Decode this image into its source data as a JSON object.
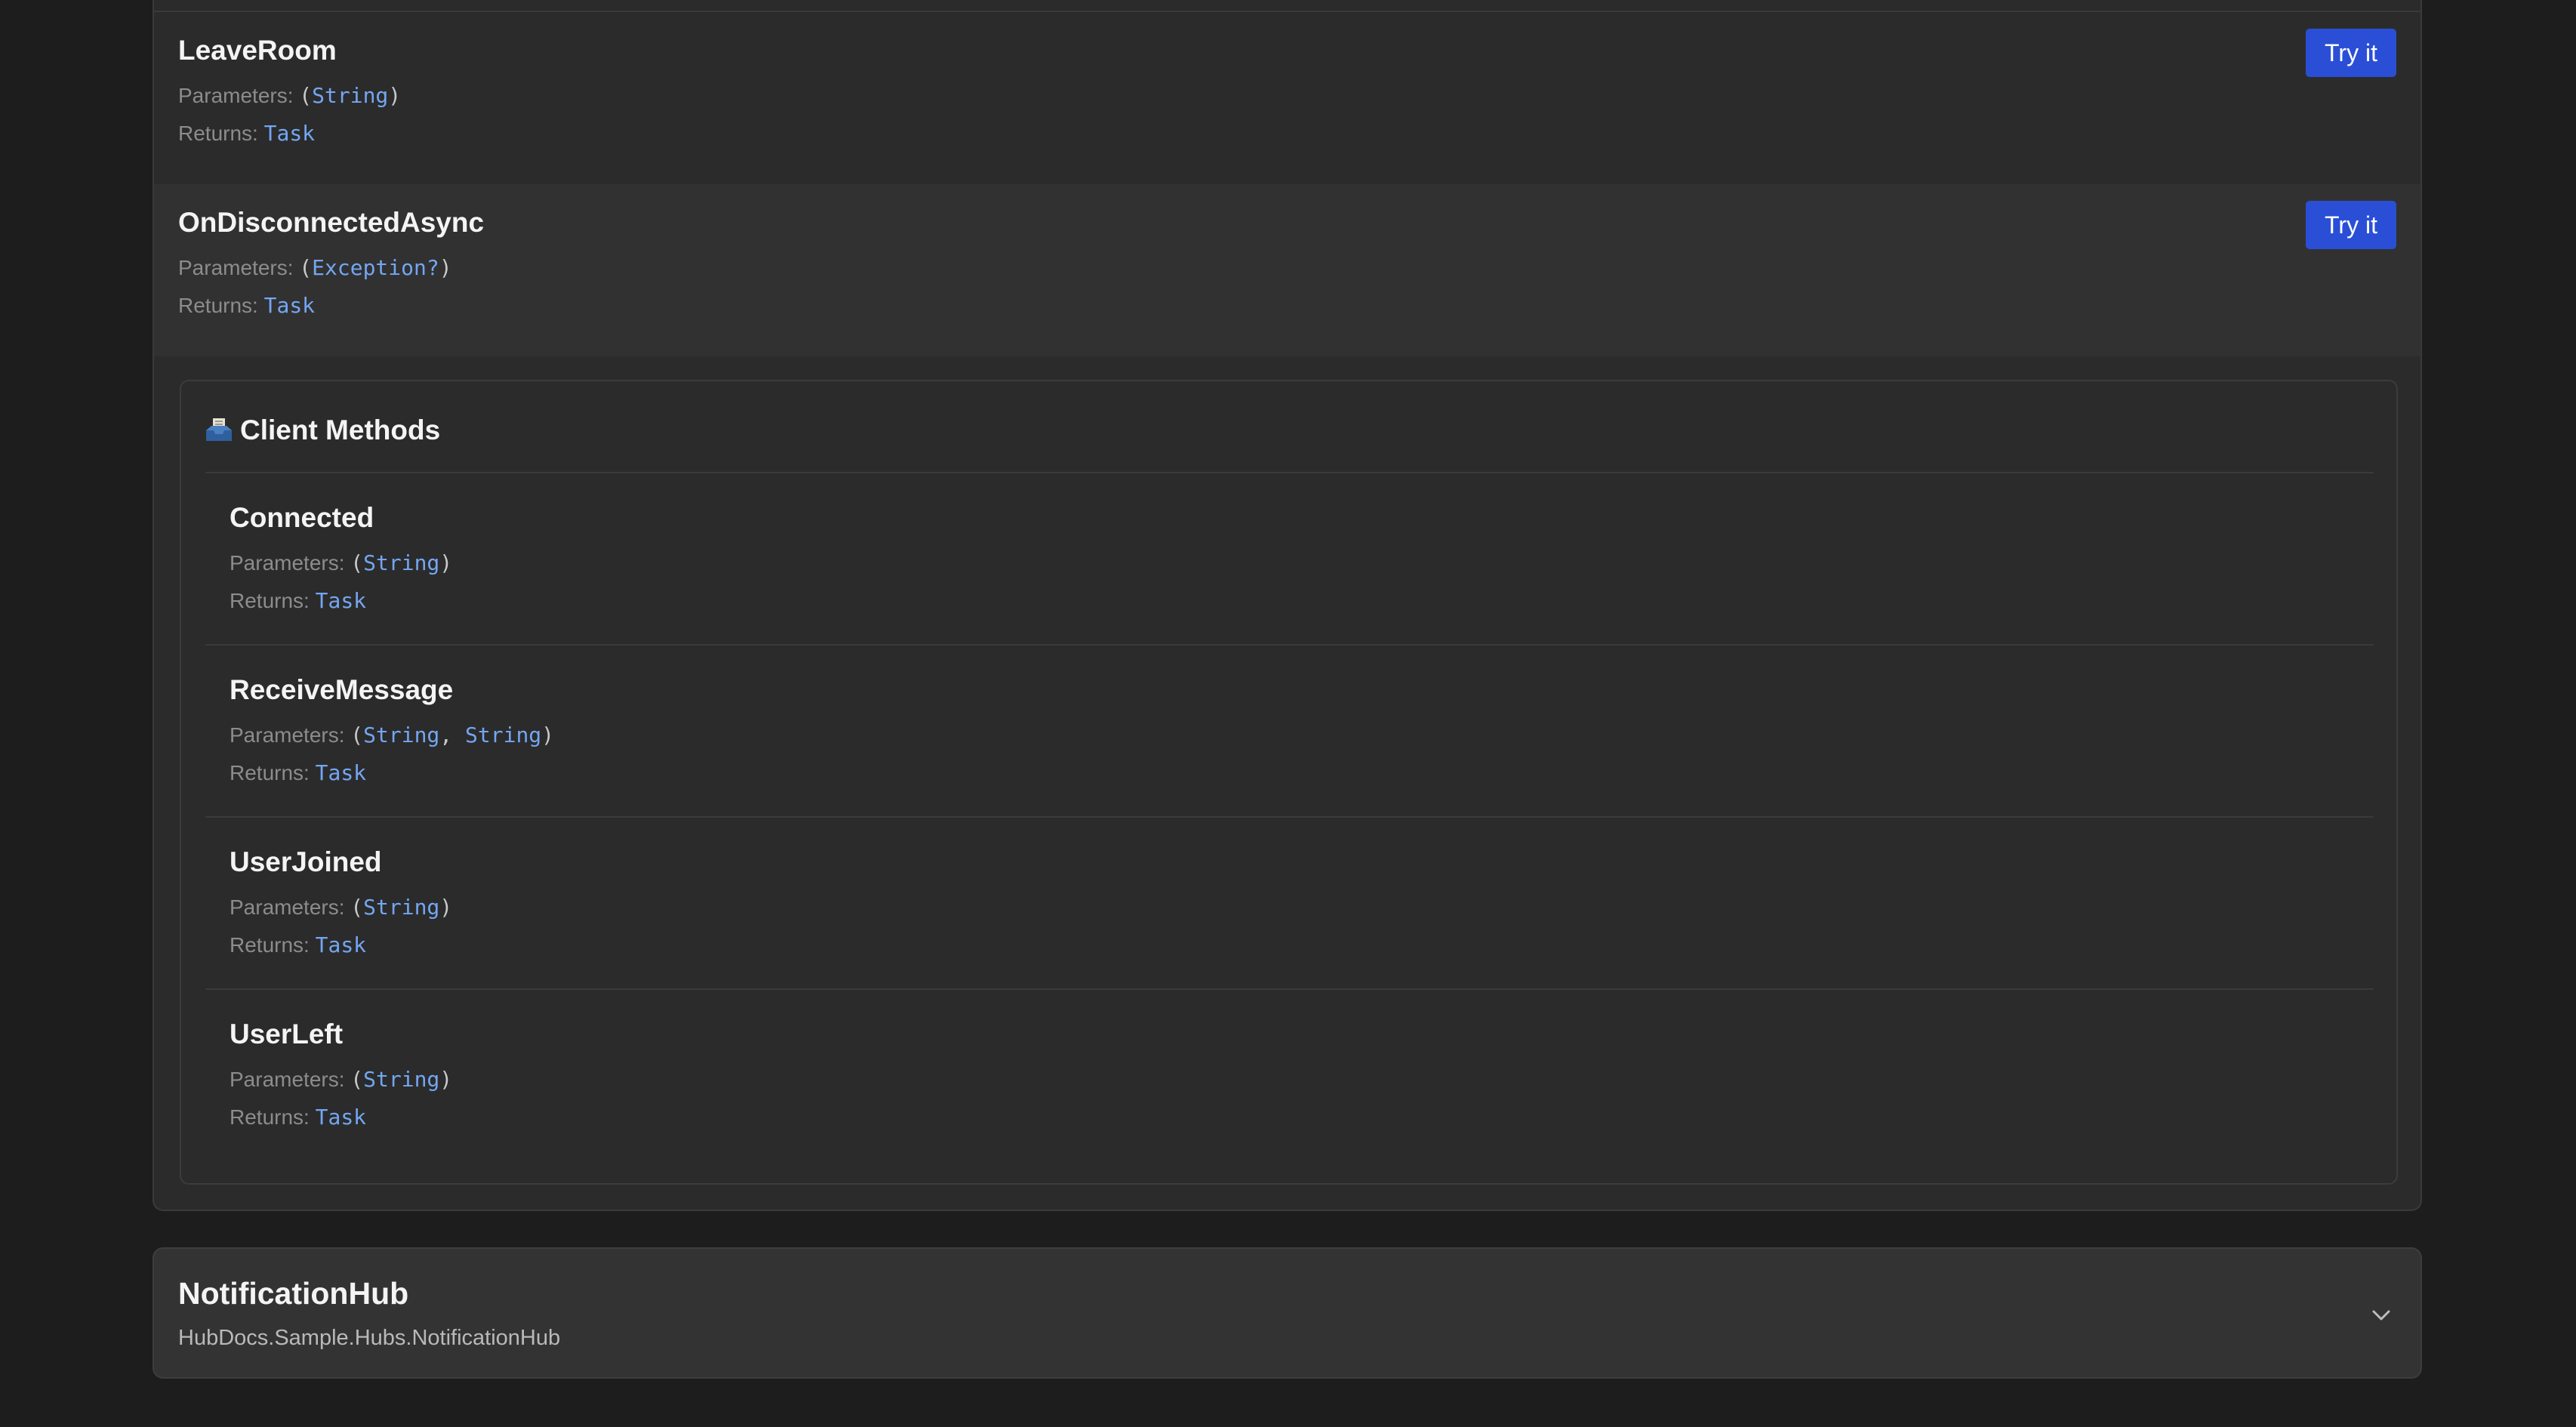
{
  "labels": {
    "parameters": "Parameters:",
    "returns": "Returns:",
    "open_paren": "(",
    "close_paren": ")",
    "separator": ", "
  },
  "server_methods": [
    {
      "name": "LeaveRoom",
      "params": [
        "String"
      ],
      "returns": "Task",
      "button": "Try it"
    },
    {
      "name": "OnDisconnectedAsync",
      "params": [
        "Exception?"
      ],
      "returns": "Task",
      "button": "Try it"
    }
  ],
  "client_section": {
    "icon": "inbox-tray-icon",
    "title": "Client Methods",
    "methods": [
      {
        "name": "Connected",
        "params": [
          "String"
        ],
        "returns": "Task"
      },
      {
        "name": "ReceiveMessage",
        "params": [
          "String",
          "String"
        ],
        "returns": "Task"
      },
      {
        "name": "UserJoined",
        "params": [
          "String"
        ],
        "returns": "Task"
      },
      {
        "name": "UserLeft",
        "params": [
          "String"
        ],
        "returns": "Task"
      }
    ]
  },
  "notification_hub": {
    "title": "NotificationHub",
    "namespace": "HubDocs.Sample.Hubs.NotificationHub",
    "icon": "chevron-down-icon"
  },
  "colors": {
    "background": "#1d1d1d",
    "card": "#2b2b2b",
    "card_alt": "#313131",
    "accent_button": "#2a4fd6",
    "type_link": "#74a6f2",
    "muted_text": "#8c8c8c"
  }
}
